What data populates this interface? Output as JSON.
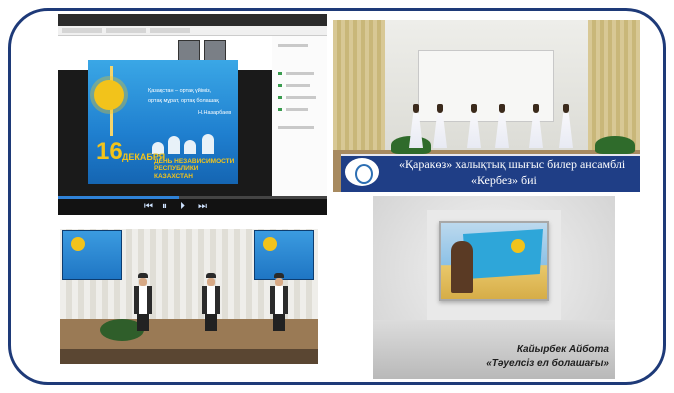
{
  "panels": {
    "video_call": {
      "slide": {
        "line1": "Қазақстан – ортақ үйіміз,",
        "line2": "ортақ мұрат, ортақ болашақ",
        "author": "Н.Назарбаев",
        "date_number": "16",
        "date_month": "ДЕКАБРЯ",
        "caption_line1": "ДЕНЬ НЕЗАВИСИМОСТИ",
        "caption_line2": "РЕСПУБЛИКИ КАЗАХСТАН"
      },
      "progress": 0.45
    },
    "dance": {
      "banner_line1": "«Қаракөз» халықтық шығыс билер ансамблі",
      "banner_line2": "«Кербез» биі"
    },
    "painting": {
      "author": "Кайырбек Айбота",
      "title": "«Тәуелсіз ел болашағы»"
    }
  },
  "colors": {
    "frame_border": "#1e3a78",
    "banner": "#1f3e86",
    "flag_blue": "#2ea6d9",
    "gold": "#f2c31b"
  }
}
